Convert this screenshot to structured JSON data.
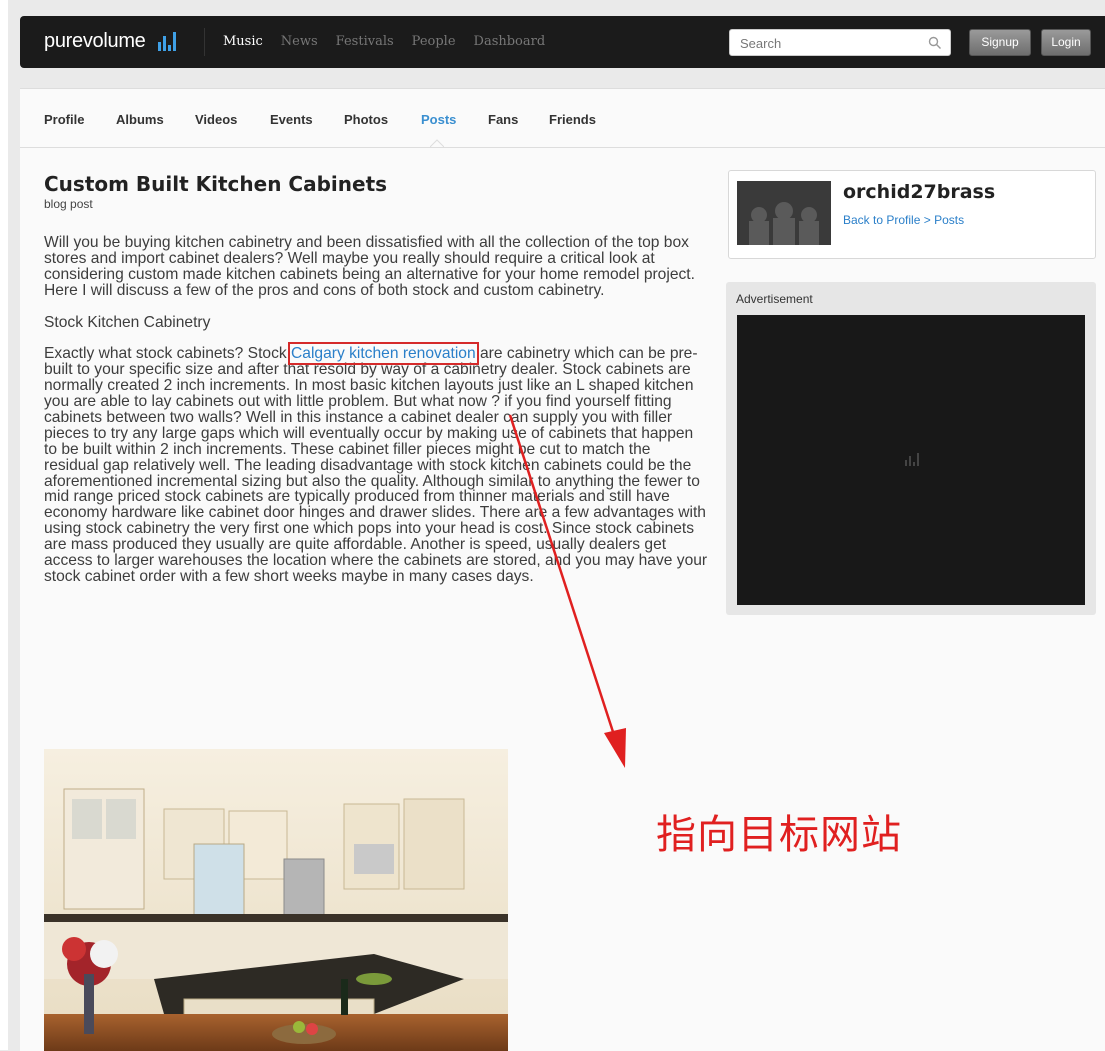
{
  "header": {
    "logo": "purevolume",
    "nav": [
      "Music",
      "News",
      "Festivals",
      "People",
      "Dashboard"
    ],
    "nav_active": "Music",
    "search_placeholder": "Search",
    "signup_label": "Signup",
    "login_label": "Login"
  },
  "tabs": [
    "Profile",
    "Albums",
    "Videos",
    "Events",
    "Photos",
    "Posts",
    "Fans",
    "Friends"
  ],
  "active_tab": "Posts",
  "post": {
    "title": "Custom Built Kitchen Cabinets",
    "type": "blog post",
    "intro": "Will you be buying kitchen cabinetry and been dissatisfied with all the collection of the top box stores and import cabinet dealers? Well maybe you really should require a critical look at considering custom made kitchen cabinets being an alternative for your home remodel project. Here I will discuss a few of the pros and cons of both stock and custom cabinetry.",
    "section_heading": "Stock Kitchen Cabinetry",
    "body_before_link": "Exactly what stock cabinets? Stock ",
    "link_text": "Calgary kitchen renovation",
    "body_after_link": " are cabinetry which can be pre-built to your specific size and after that resold by way of a cabinetry dealer. Stock cabinets are normally created 2 inch increments. In most basic kitchen layouts just like an L shaped kitchen you are able to lay cabinets out with little problem. But what now ? if you find yourself fitting cabinets between two walls? Well in this instance a cabinet dealer can supply you with filler pieces to try any large gaps which will eventually occur by making use of cabinets that happen to be built within 2 inch increments. These cabinet filler pieces might be cut to match the residual gap relatively well. The leading disadvantage with stock kitchen cabinets could be the aforementioned incremental sizing but also the quality. Although similar to anything the fewer to mid range priced stock cabinets are typically produced from thinner materials and still have economy hardware like cabinet door hinges and drawer slides. There are a few advantages with using stock cabinetry the very first one which pops into your head is cost. Since stock cabinets are mass produced they usually are quite affordable. Another is speed, usually dealers get access to larger warehouses the location where the cabinets are stored, and you may have your stock cabinet order with a few short weeks maybe in many cases days."
  },
  "sidebar": {
    "username": "orchid27brass",
    "crumb_profile": "Back to Profile",
    "crumb_sep": " > ",
    "crumb_posts": "Posts",
    "ad_label": "Advertisement"
  },
  "annotation": {
    "text": "指向目标网站",
    "color": "#e02020"
  },
  "colors": {
    "accent": "#3a8fd0",
    "link": "#2a7fc9",
    "topbar": "#1b1b1b"
  }
}
